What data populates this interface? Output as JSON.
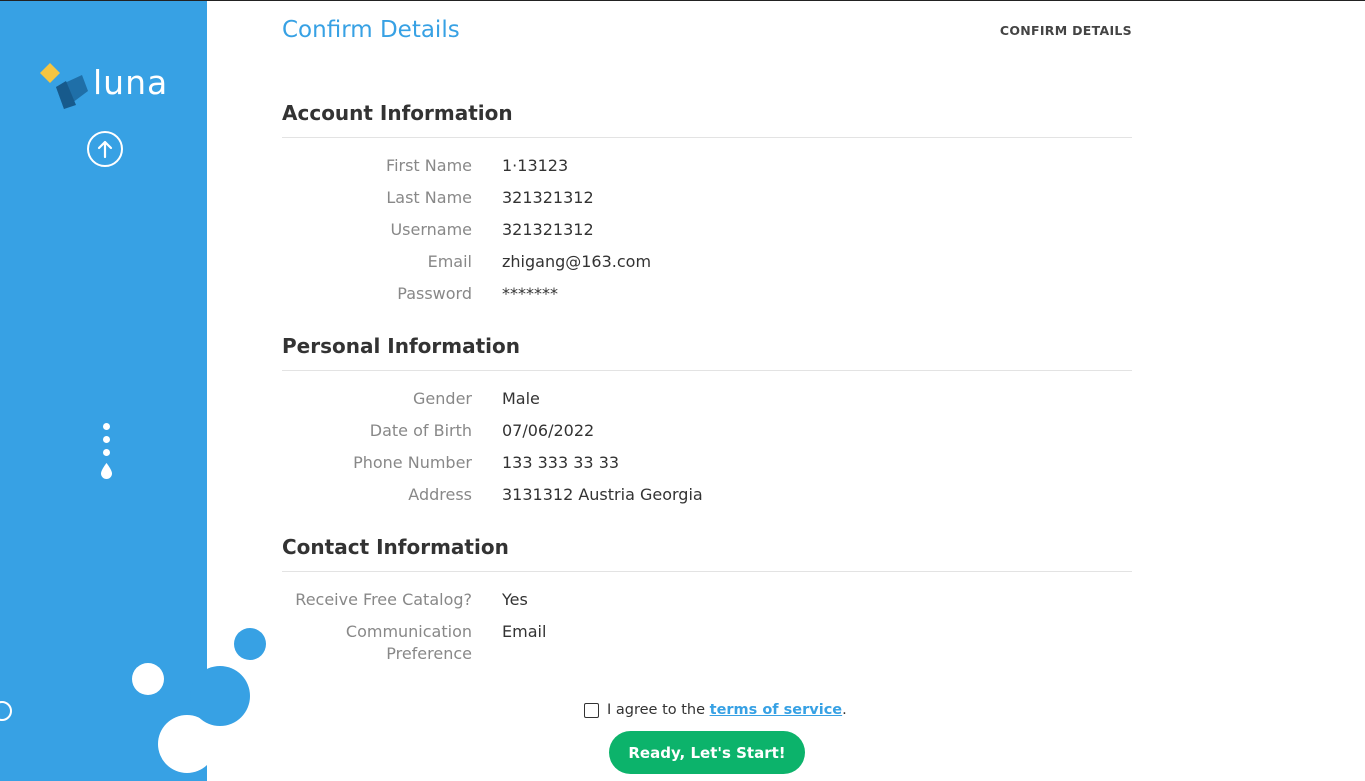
{
  "brand": {
    "name": "luna",
    "accent": "#37a1e4",
    "button_green": "#0cb36b"
  },
  "header": {
    "title": "Confirm Details",
    "step": "CONFIRM DETAILS"
  },
  "sections": {
    "account": {
      "title": "Account Information",
      "rows": [
        {
          "label": "First Name",
          "value": "1·13123"
        },
        {
          "label": "Last Name",
          "value": "321321312"
        },
        {
          "label": "Username",
          "value": "321321312"
        },
        {
          "label": "Email",
          "value": "zhigang@163.com"
        },
        {
          "label": "Password",
          "value": "*******"
        }
      ]
    },
    "personal": {
      "title": "Personal Information",
      "rows": [
        {
          "label": "Gender",
          "value": "Male"
        },
        {
          "label": "Date of Birth",
          "value": "07/06/2022"
        },
        {
          "label": "Phone Number",
          "value": "133 333 33 33"
        },
        {
          "label": "Address",
          "value": "3131312 Austria Georgia"
        }
      ]
    },
    "contact": {
      "title": "Contact Information",
      "rows": [
        {
          "label": "Receive Free Catalog?",
          "value": "Yes"
        },
        {
          "label_line1": "Communication",
          "label_line2": "Preference",
          "value": "Email"
        }
      ]
    }
  },
  "agreement": {
    "prefix": "I agree to the ",
    "link": "terms of service",
    "suffix": ".",
    "checked": false
  },
  "actions": {
    "start_label": "Ready, Let's Start!"
  },
  "icons": [
    "luna-logo-icon",
    "arrow-up-icon",
    "vertical-dots-icon"
  ]
}
